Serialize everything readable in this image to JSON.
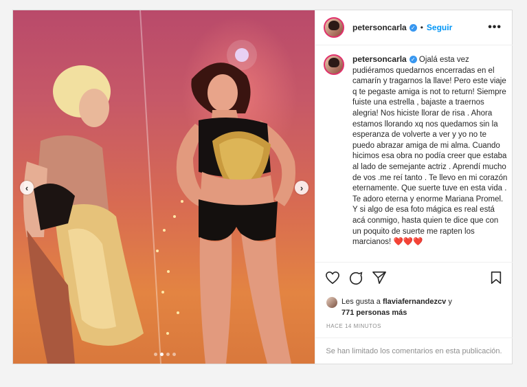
{
  "post": {
    "username": "petersoncarla",
    "separator": "•",
    "follow_label": "Seguir",
    "more_icon": "•••",
    "caption": "Ojalá esta vez pudiéramos quedarnos encerradas en el camarín y tragarnos la llave! Pero este viaje q te pegaste amiga is not to return! Siempre fuiste una estrella , bajaste a traernos alegria! Nos hiciste llorar de risa . Ahora estamos llorando xq nos quedamos sin la esperanza de volverte a ver y yo no te puedo abrazar amiga de mi alma. Cuando hicimos esa obra no podía creer que estaba al lado de semejante actriz . Aprendí mucho de vos .me reí tanto . Te llevo en mi corazón eternamente. Que suerte tuve en esta vida . Te adoro eterna y enorme Mariana Promel. Y si algo de esa foto mágica es real está acá conmigo, hasta quien te dice que con un poquito de suerte me rapten los marcianos!",
    "caption_hearts": "❤️❤️❤️",
    "likes_prefix": "Les gusta a",
    "likes_user": "flaviafernandezcv",
    "likes_join": "y",
    "likes_others": "771 personas más",
    "timestamp": "HACE 14 MINUTOS",
    "comments_limited": "Se han limitado los comentarios en esta publicación.",
    "carousel": {
      "count": 4,
      "active_index": 1
    }
  },
  "icons": {
    "verified": "verified-badge-icon",
    "prev": "chevron-left-icon",
    "next": "chevron-right-icon",
    "like": "heart-icon",
    "comment": "comment-icon",
    "share": "paper-plane-icon",
    "save": "bookmark-icon"
  },
  "colors": {
    "accent": "#0095f6",
    "verified": "#3897f0",
    "story_ring": "#e1306c"
  }
}
